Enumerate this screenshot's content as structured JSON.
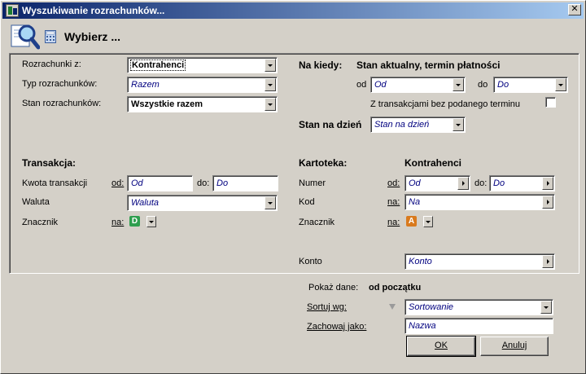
{
  "window": {
    "title": "Wyszukiwanie rozrachunków...",
    "close_glyph": "✕",
    "icon": "app-icon"
  },
  "header": {
    "title": "Wybierz ...",
    "big_icon": "magnifier-icon",
    "small_icon": "calculator-icon"
  },
  "left": {
    "rozrachunki_z": {
      "label": "Rozrachunki z:",
      "value": "Kontrahenci"
    },
    "typ": {
      "label": "Typ rozrachunków:",
      "placeholder": "Razem"
    },
    "stan": {
      "label": "Stan rozrachunków:",
      "value": "Wszystkie razem"
    },
    "transakcja_heading": "Transakcja:",
    "kwota": {
      "label": "Kwota transakcji",
      "od_link": "od:",
      "od_placeholder": "Od",
      "do_label": "do:",
      "do_placeholder": "Do"
    },
    "waluta": {
      "label": "Waluta",
      "placeholder": "Waluta"
    },
    "znacznik": {
      "label": "Znacznik",
      "na_link": "na:",
      "badge": "D",
      "badge_color": "#2e9e4e"
    }
  },
  "right": {
    "na_kiedy": {
      "label": "Na kiedy:",
      "value": "Stan aktualny, termin płatności"
    },
    "od": {
      "label": "od",
      "placeholder": "Od"
    },
    "do": {
      "label": "do",
      "placeholder": "Do"
    },
    "bez_terminu": {
      "label": "Z transakcjami bez podanego terminu",
      "checked": false
    },
    "stan_na_dzien": {
      "label": "Stan na dzień",
      "placeholder": "Stan na dzień"
    },
    "kartoteka": {
      "label": "Kartoteka:",
      "value": "Kontrahenci"
    },
    "numer": {
      "label": "Numer",
      "od_link": "od:",
      "od_placeholder": "Od",
      "do_label": "do:",
      "do_placeholder": "Do"
    },
    "kod": {
      "label": "Kod",
      "na_link": "na:",
      "placeholder": "Na"
    },
    "znacznik": {
      "label": "Znacznik",
      "na_link": "na:",
      "badge": "A",
      "badge_color": "#d97a1e"
    },
    "konto": {
      "label": "Konto",
      "placeholder": "Konto"
    }
  },
  "bottom": {
    "pokaz_dane": {
      "label": "Pokaż dane:",
      "value": "od początku"
    },
    "sortuj": {
      "label": "Sortuj wg:",
      "placeholder": "Sortowanie"
    },
    "zachowaj": {
      "label": "Zachowaj jako:",
      "placeholder": "Nazwa"
    },
    "ok_label": "OK",
    "cancel_label": "Anuluj"
  }
}
